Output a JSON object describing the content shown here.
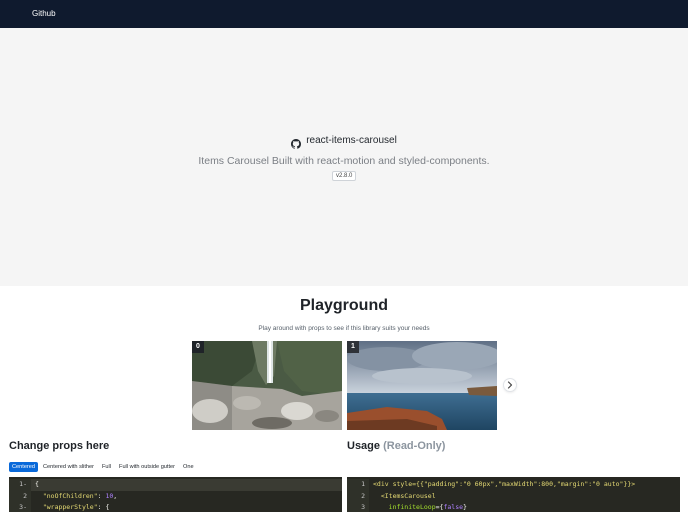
{
  "navbar": {
    "github_label": "Github"
  },
  "hero": {
    "title": "react-items-carousel",
    "subtitle": "Items Carousel Built with react-motion and styled-components.",
    "version": "v2.8.0"
  },
  "playground": {
    "title": "Playground",
    "subtitle": "Play around with props to see if this library suits your needs",
    "cards": [
      {
        "index": "0"
      },
      {
        "index": "1"
      }
    ]
  },
  "props_panel": {
    "title": "Change props here",
    "tabs": [
      "Centered",
      "Centered with slither",
      "Full",
      "Full with outside gutter",
      "One"
    ],
    "active_tab": "Centered",
    "code_lines": [
      {
        "num": "1",
        "text": "{"
      },
      {
        "num": "2",
        "key": "\"noOfChildren\"",
        "value": "10"
      },
      {
        "num": "3",
        "key": "\"wrapperStyle\"",
        "value": "{"
      }
    ]
  },
  "usage_panel": {
    "title": "Usage",
    "title_suffix": "(Read-Only)",
    "code_lines": [
      {
        "num": "1",
        "text": "<div style={{\"padding\":\"0 60px\",\"maxWidth\":800,\"margin\":\"0 auto\"}}>"
      },
      {
        "num": "2",
        "text": "  <ItemsCarousel"
      },
      {
        "num": "3",
        "attr": "infiniteLoop",
        "value": "false"
      }
    ]
  },
  "colors": {
    "navbar_bg": "#0f1a2e",
    "hero_bg": "#f5f5f5",
    "active_tab": "#0969da",
    "code_bg": "#272822"
  },
  "icons": {
    "github": "github-icon",
    "next": "chevron-right-icon"
  }
}
